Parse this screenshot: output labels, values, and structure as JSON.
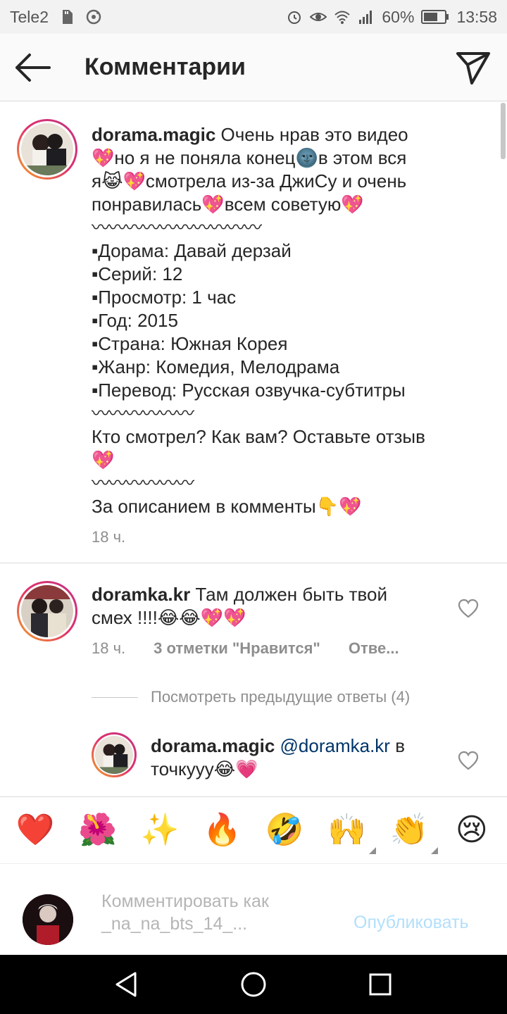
{
  "status_bar": {
    "carrier": "Tele2",
    "battery": "60%",
    "time": "13:58"
  },
  "header": {
    "title": "Комментарии"
  },
  "caption": {
    "username": "dorama.magic",
    "line1": "Очень нрав это видео",
    "line2a": "но я не поняла конец",
    "line2b": "в этом вся",
    "line3a": "я",
    "line3b": "смотрела из-за ДжиСу и очень",
    "line4a": "понравилась",
    "line4b": "всем советую",
    "wave_long": "〰〰〰〰〰〰〰〰〰〰",
    "details": [
      "▪Дорама: Давай дерзай",
      "▪Серий: 12",
      "▪Просмотр: 1 час",
      "▪Год: 2015",
      "▪Страна: Южная Корея",
      "▪Жанр: Комедия, Мелодрама",
      "▪Перевод: Русская озвучка-субтитры"
    ],
    "wave_short": "〰〰〰〰〰〰",
    "question": "Кто смотрел? Как вам? Оставьте отзыв",
    "footer": "За описанием в комменты",
    "time": "18 ч."
  },
  "comment1": {
    "username": "doramka.kr",
    "text_a": "Там должен быть твой",
    "text_b": "смех !!!!",
    "emojis": "😂😂💖💖",
    "time": "18 ч.",
    "likes": "3 отметки \"Нравится\"",
    "reply": "Отве..."
  },
  "view_previous": "Посмотреть предыдущие ответы (4)",
  "reply1": {
    "username": "dorama.magic",
    "mention": "@doramka.kr",
    "text_a": "в",
    "text_b": "точкууу",
    "emojis": "😂💗"
  },
  "emoji_bar": [
    "❤️",
    "🌺",
    "✨",
    "🔥",
    "🤣",
    "🙌",
    "👏",
    "😢"
  ],
  "input": {
    "placeholder_line1": "Комментировать как",
    "placeholder_line2": "_na_na_bts_14_...",
    "publish": "Опубликовать"
  },
  "emoji_glyphs": {
    "sparkle_heart": "💖",
    "dark_face": "🌚",
    "grin_cat": "😹",
    "point_down": "👇"
  }
}
